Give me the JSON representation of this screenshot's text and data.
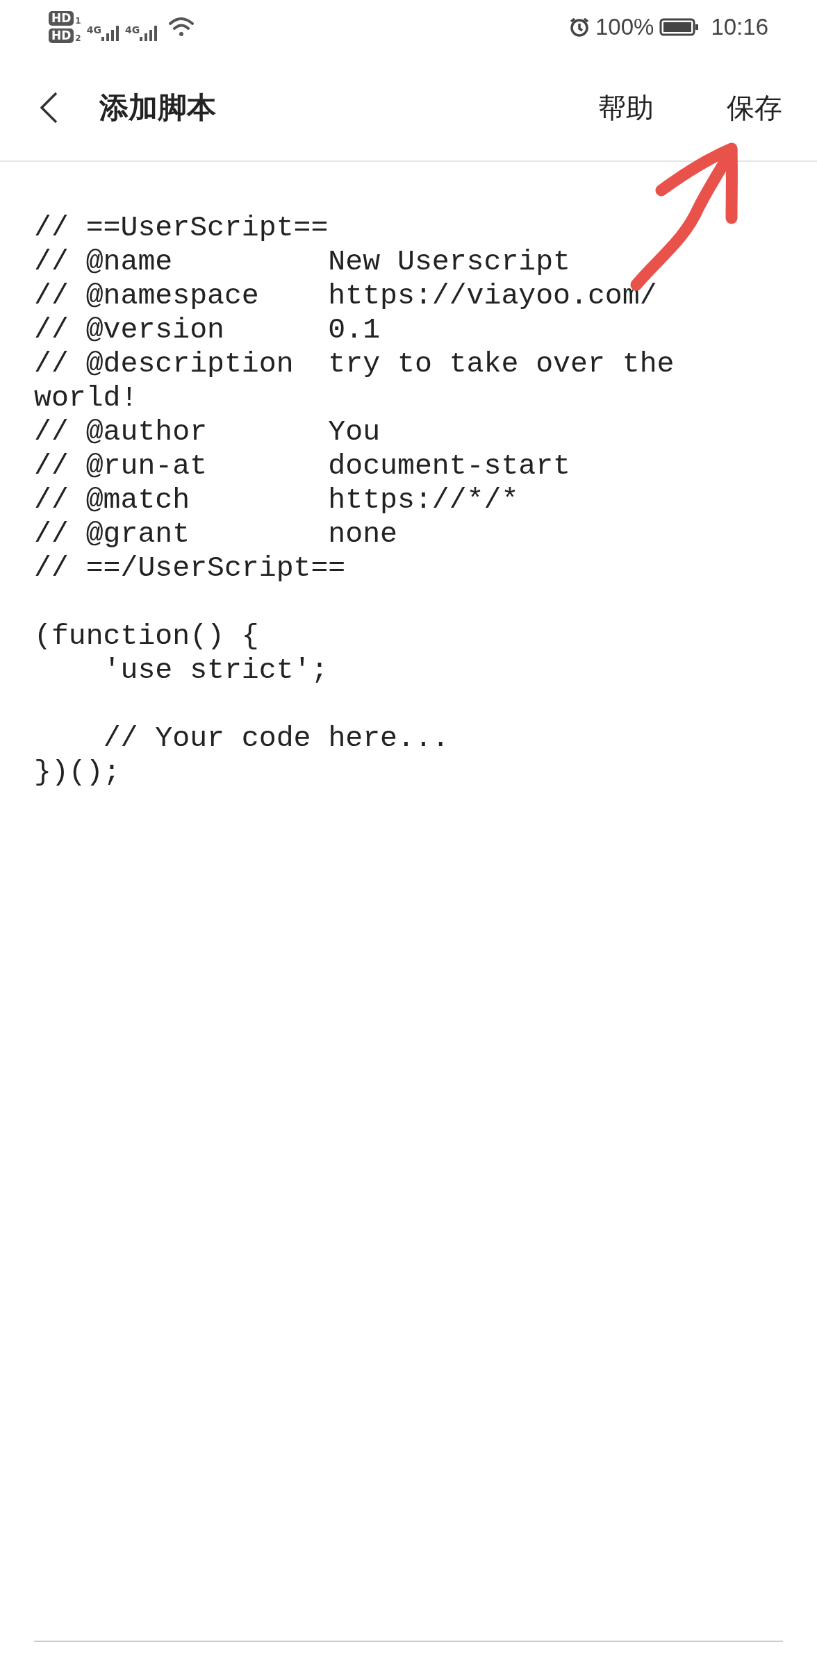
{
  "status_bar": {
    "sims": [
      {
        "label": "HD",
        "slot": "1"
      },
      {
        "label": "HD",
        "slot": "2"
      }
    ],
    "networks": [
      "4G",
      "4G"
    ],
    "battery_text": "100%",
    "time": "10:16"
  },
  "header": {
    "title": "添加脚本",
    "actions": [
      "帮助",
      "保存"
    ]
  },
  "code": {
    "blocks": [
      [
        "// ==UserScript==",
        "// @name         New Userscript",
        "// @namespace    https://viayoo.com/",
        "// @version      0.1",
        "// @description  try to take over the world!",
        "// @author       You",
        "// @run-at       document-start",
        "// @match        https://*/*",
        "// @grant        none",
        "// ==/UserScript=="
      ],
      [
        "(function() {",
        "    'use strict';"
      ],
      [
        "    // Your code here...",
        "})();"
      ]
    ]
  }
}
